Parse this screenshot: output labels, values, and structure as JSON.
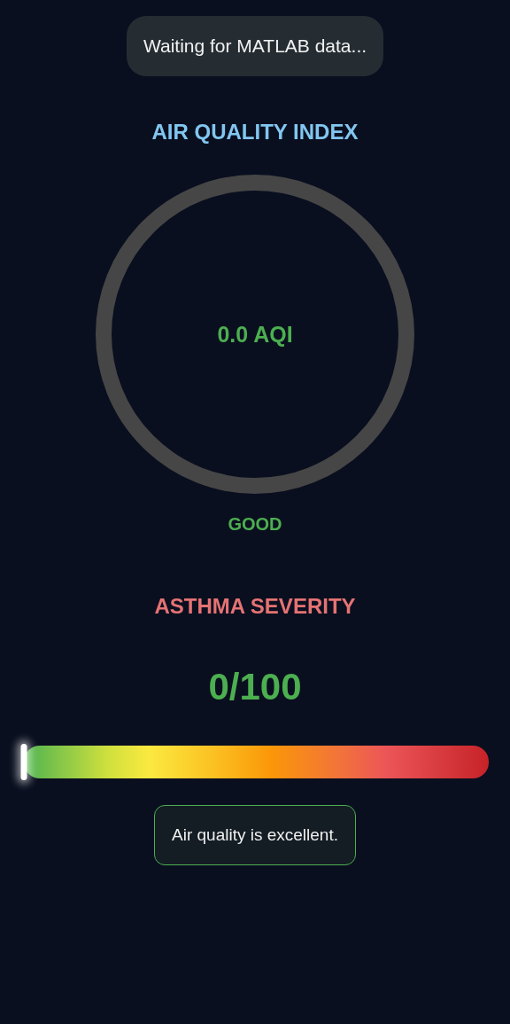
{
  "status": {
    "text": "Waiting for MATLAB data..."
  },
  "aqi": {
    "title": "AIR QUALITY INDEX",
    "reading": "0.0 AQI",
    "level": 0,
    "category": "GOOD"
  },
  "asthma": {
    "title": "ASTHMA SEVERITY",
    "score": "0/100",
    "level": 0
  },
  "message": {
    "text": "Air quality is excellent."
  }
}
